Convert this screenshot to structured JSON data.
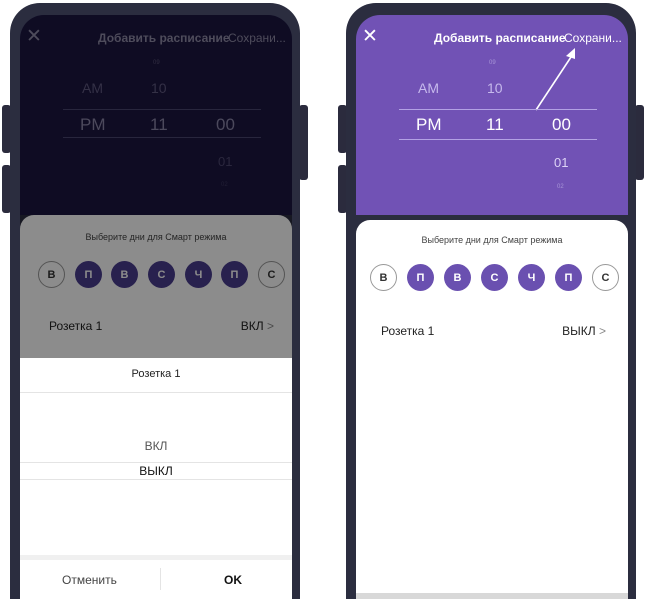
{
  "colors": {
    "frame": "#2b2d3f",
    "purple": "#7152b5",
    "dark_purple": "#1c1640",
    "day_active": "#4a3c8e"
  },
  "left": {
    "header": {
      "close_icon": "✕",
      "title": "Добавить расписание",
      "save": "Сохрани..."
    },
    "picker": {
      "ampm": [
        "AM",
        "PM"
      ],
      "hours": [
        "10",
        "11"
      ],
      "minutes": [
        "00",
        "01"
      ],
      "faint_top": "09",
      "faint_bottom": "02"
    },
    "card": {
      "days_label": "Выберите дни для Смарт режима",
      "days": [
        {
          "label": "В",
          "active": false
        },
        {
          "label": "П",
          "active": true
        },
        {
          "label": "В",
          "active": true
        },
        {
          "label": "С",
          "active": true
        },
        {
          "label": "Ч",
          "active": true
        },
        {
          "label": "П",
          "active": true
        },
        {
          "label": "С",
          "active": false
        }
      ],
      "row_label": "Розетка 1",
      "row_value": "ВКЛ",
      "row_chevron": ">"
    },
    "sheet": {
      "title": "Розетка 1",
      "options": [
        "ВКЛ",
        "ВЫКЛ"
      ],
      "cancel": "Отменить",
      "ok": "OK"
    }
  },
  "right": {
    "header": {
      "close_icon": "✕",
      "title": "Добавить расписание",
      "save": "Сохрани..."
    },
    "picker": {
      "ampm": [
        "AM",
        "PM"
      ],
      "hours": [
        "10",
        "11"
      ],
      "minutes": [
        "00",
        "01"
      ],
      "faint_top": "09",
      "faint_bottom": "02"
    },
    "card": {
      "days_label": "Выберите дни для Смарт режима",
      "days": [
        {
          "label": "В",
          "active": false
        },
        {
          "label": "П",
          "active": true
        },
        {
          "label": "В",
          "active": true
        },
        {
          "label": "С",
          "active": true
        },
        {
          "label": "Ч",
          "active": true
        },
        {
          "label": "П",
          "active": true
        },
        {
          "label": "С",
          "active": false
        }
      ],
      "row_label": "Розетка 1",
      "row_value": "ВЫКЛ",
      "row_chevron": ">"
    }
  }
}
